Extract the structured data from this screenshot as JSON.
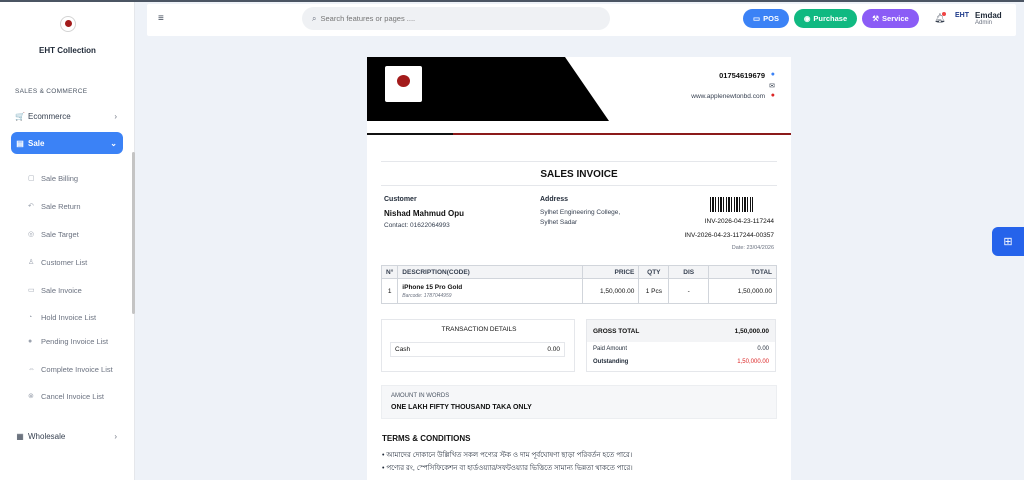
{
  "brand": {
    "name": "EHT Collection"
  },
  "sidebar": {
    "section_title": "SALES & COMMERCE",
    "items": [
      {
        "label": "Ecommerce",
        "icon": "cart-icon"
      },
      {
        "label": "Sale",
        "icon": "receipt-icon",
        "active": true
      },
      {
        "label": "Wholesale",
        "icon": "boxes-icon"
      }
    ],
    "sale_subitems": [
      {
        "label": "Sale Billing",
        "icon": "document-icon"
      },
      {
        "label": "Sale Return",
        "icon": "return-icon"
      },
      {
        "label": "Sale Target",
        "icon": "target-icon"
      },
      {
        "label": "Customer List",
        "icon": "user-icon"
      },
      {
        "label": "Sale Invoice",
        "icon": "invoice-icon"
      },
      {
        "label": "Hold Invoice List",
        "icon": "clock-icon"
      },
      {
        "label": "Pending Invoice List",
        "icon": "hourglass-icon"
      },
      {
        "label": "Complete Invoice List",
        "icon": "check-icon"
      },
      {
        "label": "Cancel Invoice List",
        "icon": "cancel-icon"
      }
    ]
  },
  "topbar": {
    "search_placeholder": "Search features or pages ....",
    "buttons": {
      "pos": "POS",
      "purchase": "Purchase",
      "service": "Service"
    },
    "user": {
      "name": "Emdad",
      "role": "Admin",
      "logo_text": "EHT"
    }
  },
  "invoice": {
    "phone": "01754619679",
    "website": "www.applenewtonbd.com",
    "title": "SALES INVOICE",
    "customer_label": "Customer",
    "customer_name": "Nishad Mahmud Opu",
    "customer_contact": "Contact: 01622064993",
    "address_label": "Address",
    "address_line1": "Sylhet Engineering College,",
    "address_line2": "Sylhet Sadar",
    "barcode_text": "INV-2026-04-23-117244",
    "invoice_no": "INV-2026-04-23-117244-00357",
    "date": "Date: 23/04/2026",
    "columns": [
      "N°",
      "DESCRIPTION(CODE)",
      "PRICE",
      "QTY",
      "DIS",
      "TOTAL"
    ],
    "items": [
      {
        "no": "1",
        "name": "iPhone 15 Pro Gold",
        "barcode": "Barcode: 1787044959",
        "price": "1,50,000.00",
        "qty": "1 Pcs",
        "dis": "-",
        "total": "1,50,000.00"
      }
    ],
    "transaction_title": "TRANSACTION DETAILS",
    "transaction": {
      "method": "Cash",
      "amount": "0.00"
    },
    "gross_total_label": "GROSS TOTAL",
    "gross_total": "1,50,000.00",
    "paid_label": "Paid Amount",
    "paid": "0.00",
    "outstanding_label": "Outstanding",
    "outstanding": "1,50,000.00",
    "amount_words_label": "AMOUNT IN WORDS",
    "amount_words": "ONE LAKH FIFTY THOUSAND TAKA ONLY",
    "terms_title": "TERMS & CONDITIONS",
    "terms": [
      "• আমাদের দোকানে উল্লিখিত সকল পণ্যের স্টক ও দাম পূর্বঘোষণা ছাড়া পরিবর্তন হতে পারে।",
      "• পণ্যের রং, স্পেসিফিকেশন বা হার্ডওয়্যার/সফটওয়্যার ভিত্তিতে সামান্য ভিন্নতা থাকতে পারে।"
    ]
  },
  "colors": {
    "primary": "#3b82f6",
    "purchase": "#10b981",
    "service": "#8b5cf6",
    "banner": "#000000",
    "accent_red": "#8b1a1a"
  }
}
